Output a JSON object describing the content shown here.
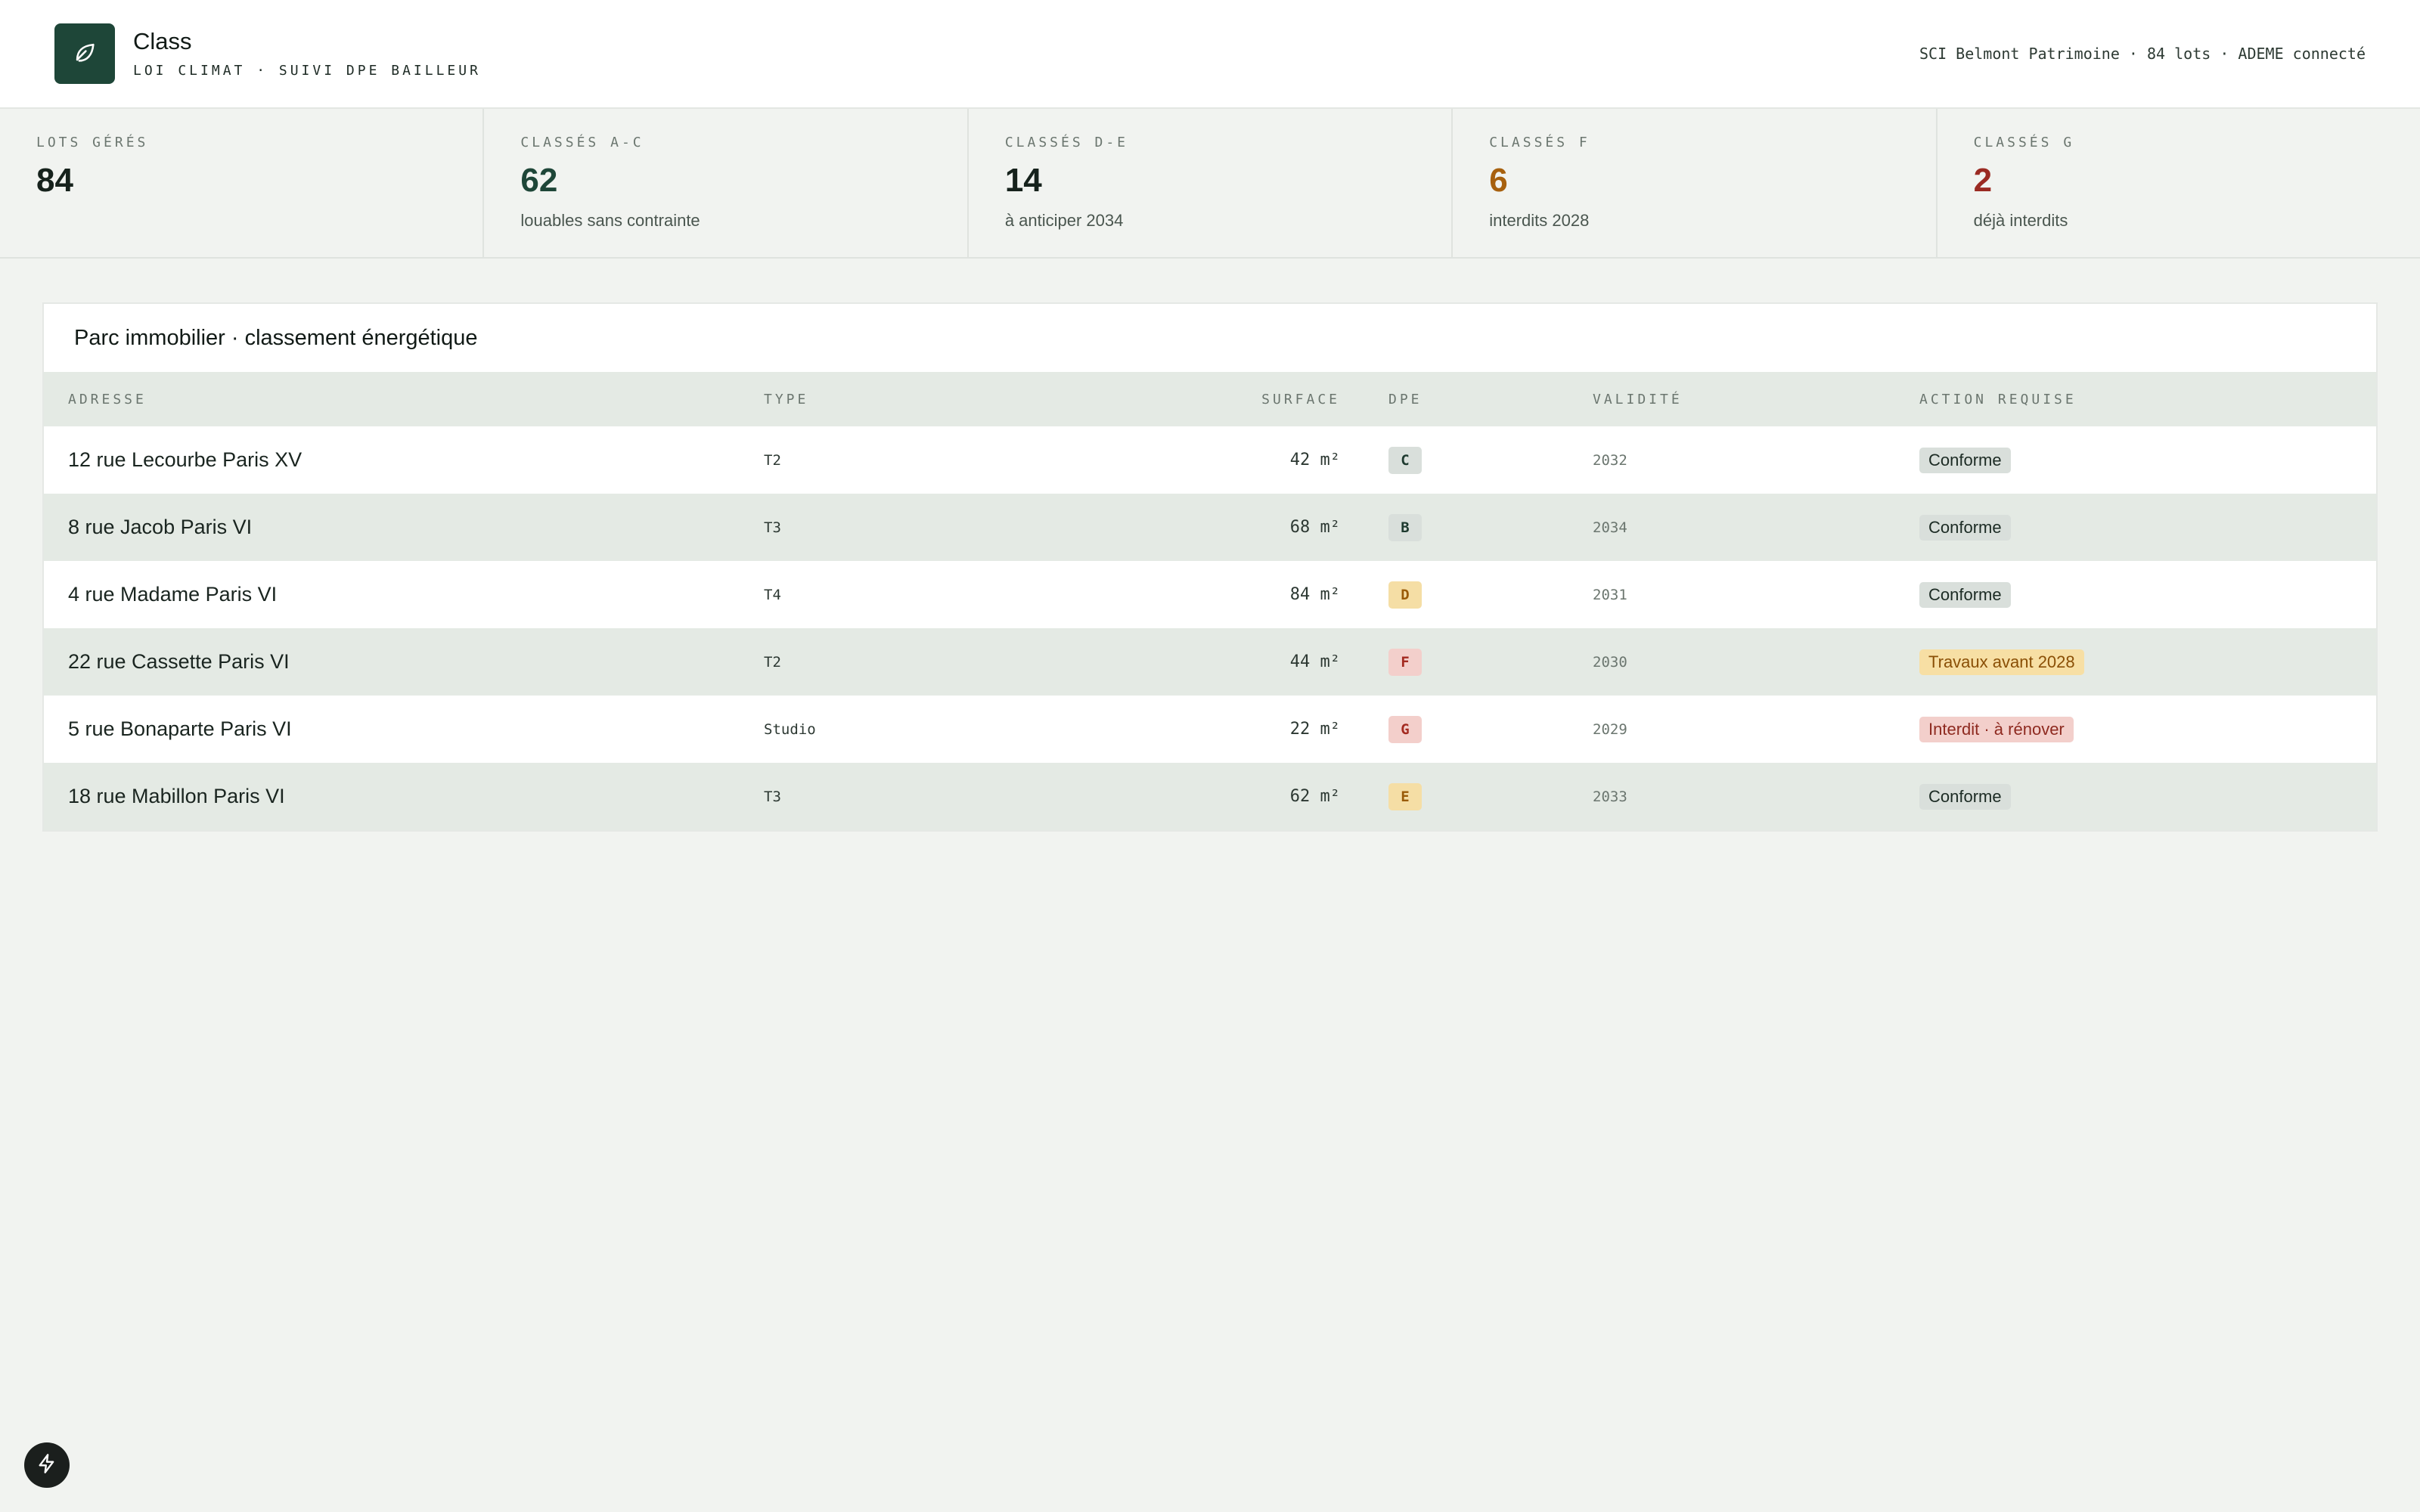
{
  "app": {
    "name": "Class",
    "tagline": "LOI CLIMAT · SUIVI DPE BAILLEUR",
    "logo_icon": "leaf-icon",
    "account_info": "SCI Belmont Patrimoine · 84 lots · ADEME connecté",
    "accent_color": "#1e4638"
  },
  "stats": [
    {
      "label": "LOTS GÉRÉS",
      "value": "84",
      "sub": "",
      "tone": "default"
    },
    {
      "label": "CLASSÉS A-C",
      "value": "62",
      "sub": "louables sans contrainte",
      "tone": "green"
    },
    {
      "label": "CLASSÉS D-E",
      "value": "14",
      "sub": "à anticiper 2034",
      "tone": "default"
    },
    {
      "label": "CLASSÉS F",
      "value": "6",
      "sub": "interdits 2028",
      "tone": "amber"
    },
    {
      "label": "CLASSÉS G",
      "value": "2",
      "sub": "déjà interdits",
      "tone": "red"
    }
  ],
  "table": {
    "title": "Parc immobilier · classement énergétique",
    "columns": [
      "ADRESSE",
      "TYPE",
      "SURFACE",
      "DPE",
      "VALIDITÉ",
      "ACTION REQUISE"
    ],
    "rows": [
      {
        "address": "12 rue Lecourbe Paris XV",
        "type": "T2",
        "surface": "42 m²",
        "dpe": "C",
        "validity": "2032",
        "action": "Conforme"
      },
      {
        "address": "8 rue Jacob Paris VI",
        "type": "T3",
        "surface": "68 m²",
        "dpe": "B",
        "validity": "2034",
        "action": "Conforme"
      },
      {
        "address": "4 rue Madame Paris VI",
        "type": "T4",
        "surface": "84 m²",
        "dpe": "D",
        "validity": "2031",
        "action": "Conforme"
      },
      {
        "address": "22 rue Cassette Paris VI",
        "type": "T2",
        "surface": "44 m²",
        "dpe": "F",
        "validity": "2030",
        "action": "Travaux avant 2028"
      },
      {
        "address": "5 rue Bonaparte Paris VI",
        "type": "Studio",
        "surface": "22 m²",
        "dpe": "G",
        "validity": "2029",
        "action": "Interdit · à rénover"
      },
      {
        "address": "18 rue Mabillon Paris VI",
        "type": "T3",
        "surface": "62 m²",
        "dpe": "E",
        "validity": "2033",
        "action": "Conforme"
      }
    ]
  },
  "dpe_colors": {
    "B": {
      "bg": "#d9dfdb",
      "fg": "#1e3a2f"
    },
    "C": {
      "bg": "#d9dfdb",
      "fg": "#1e3a2f"
    },
    "D": {
      "bg": "#f5dea5",
      "fg": "#9a5b08"
    },
    "E": {
      "bg": "#f5dea5",
      "fg": "#9a5b08"
    },
    "F": {
      "bg": "#f3cfcb",
      "fg": "#a32a20"
    },
    "G": {
      "bg": "#f3cfcb",
      "fg": "#a32a20"
    }
  },
  "action_colors": {
    "Conforme": {
      "bg": "#d9dfdb",
      "fg": "#1c2b24"
    },
    "Travaux avant 2028": {
      "bg": "#f7dfa4",
      "fg": "#8a4f06"
    },
    "Interdit · à rénover": {
      "bg": "#f3cfcb",
      "fg": "#8e2a20"
    }
  },
  "fab": {
    "icon": "bolt-icon"
  }
}
